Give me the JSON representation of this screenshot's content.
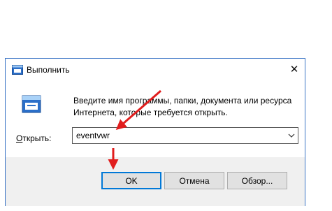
{
  "window": {
    "title": "Выполнить",
    "close_glyph": "✕"
  },
  "description": {
    "line1": "Введите имя программы, папки, документа или ресурса",
    "line2": "Интернета, которые требуется открыть."
  },
  "open_field": {
    "label_accel": "О",
    "label_rest": "ткрыть:",
    "value": "eventvwr"
  },
  "buttons": {
    "ok": "OK",
    "cancel": "Отмена",
    "browse": "Обзор..."
  },
  "colors": {
    "accent": "#0078d7",
    "annotation_arrow": "#e11d1d"
  },
  "icons": [
    "run-app-icon",
    "run-large-icon",
    "close-icon",
    "chevron-down-icon",
    "red-arrow-annotation"
  ]
}
